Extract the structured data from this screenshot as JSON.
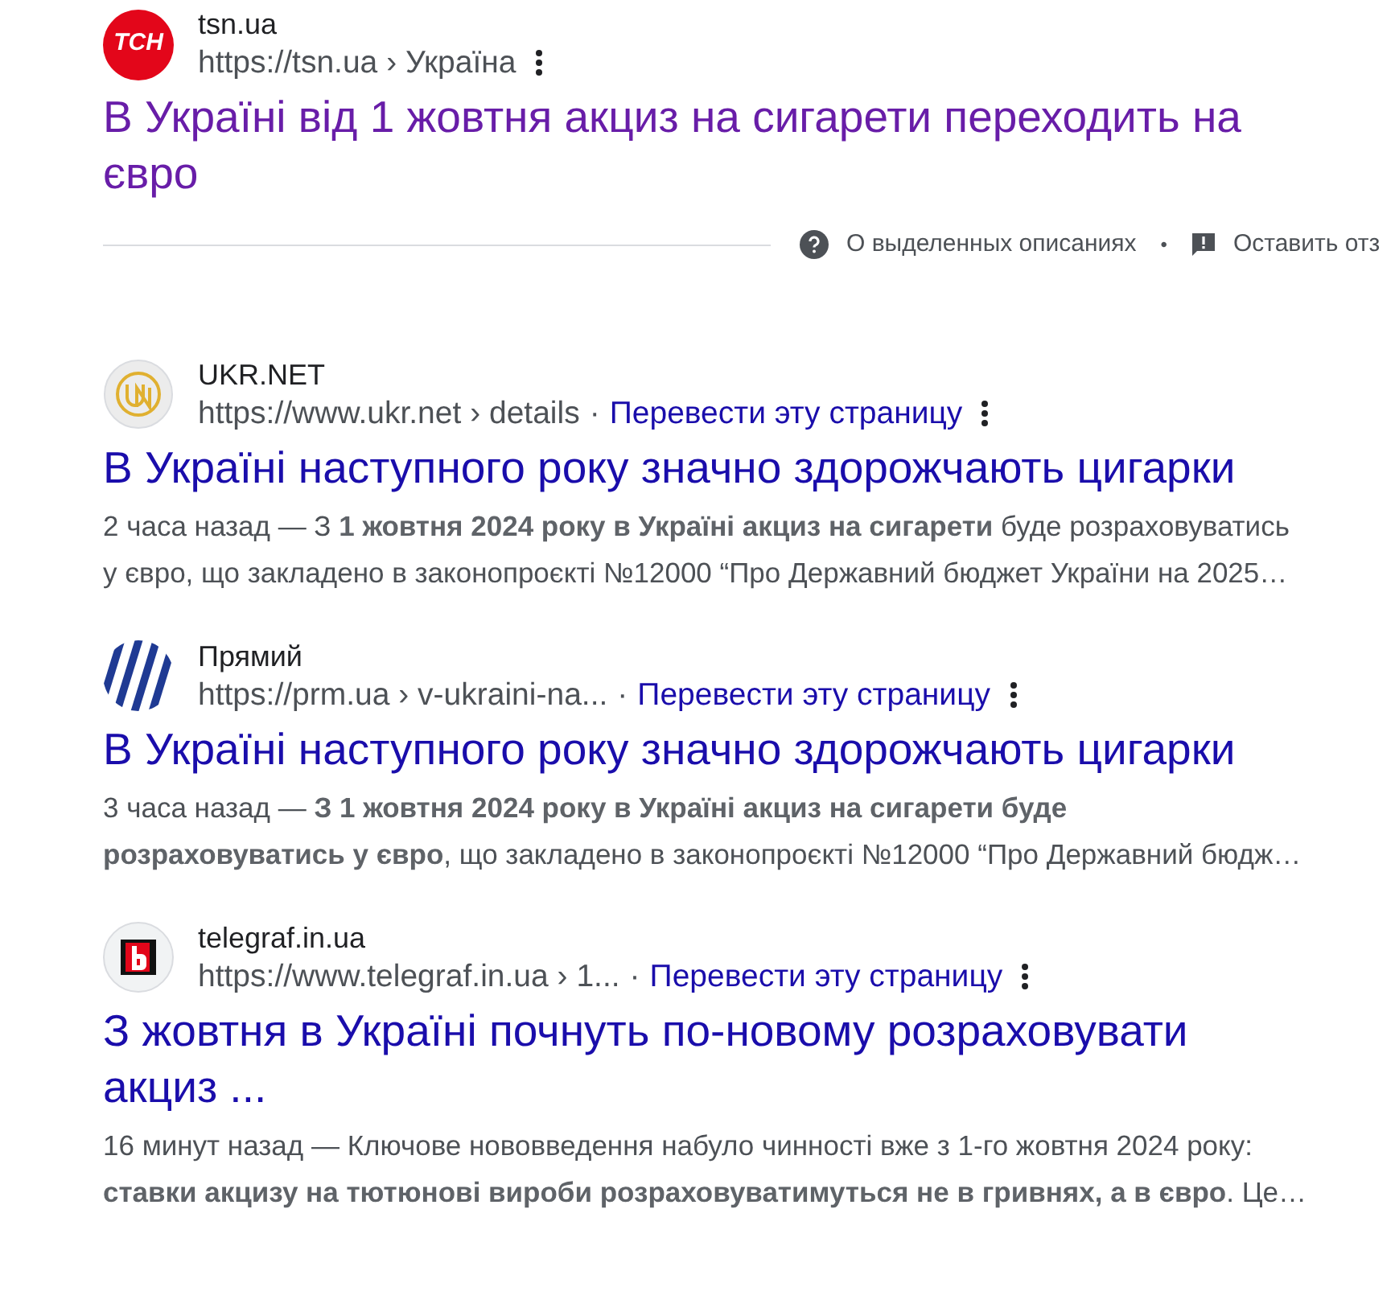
{
  "results": [
    {
      "logo": {
        "kind": "tsn",
        "text": "ТСН"
      },
      "site": "tsn.ua",
      "url": "https://tsn.ua › Україна",
      "title": "В Україні від 1 жовтня акциз на сигарети переходить на євро",
      "visited": true
    },
    {
      "logo": {
        "kind": "ukrnet"
      },
      "site": "UKR.NET",
      "url": "https://www.ukr.net › details",
      "separator": "·",
      "translate": "Перевести эту страницу",
      "title": "В Україні наступного року значно здорожчають цигарки",
      "visited": false,
      "snippet": "2 часа назад — З **1 жовтня 2024 року в Україні акциз на сигарети** буде розраховуватись у євро, що закладено в законопроєкті №12000 “Про Державний бюджет України на 2025…"
    },
    {
      "logo": {
        "kind": "prm"
      },
      "site": "Прямий",
      "url": "https://prm.ua › v-ukraini-na...",
      "separator": "·",
      "translate": "Перевести эту страницу",
      "title": "В Україні наступного року значно здорожчають цигарки",
      "visited": false,
      "snippet": "3 часа назад — **З 1 жовтня 2024 року в Україні акциз на сигарети буде розраховуватись у євро**, що закладено в законопроєкті №12000 “Про Державний бюдж…"
    },
    {
      "logo": {
        "kind": "telegraf"
      },
      "site": "telegraf.in.ua",
      "url": "https://www.telegraf.in.ua › 1...",
      "separator": "·",
      "translate": "Перевести эту страницу",
      "title": "З жовтня в Україні почнуть по-новому розраховувати акциз ...",
      "visited": false,
      "snippet": "16 минут назад — Ключове нововведення набуло чинності вже з 1-го жовтня 2024 року: **ставки акцизу на тютюнові вироби розраховуватимуться не в гривнях, а в євро**. Це…"
    }
  ],
  "feedback": {
    "about": "О выделенных описаниях",
    "separator": "•",
    "leave": "Оставить отз"
  }
}
